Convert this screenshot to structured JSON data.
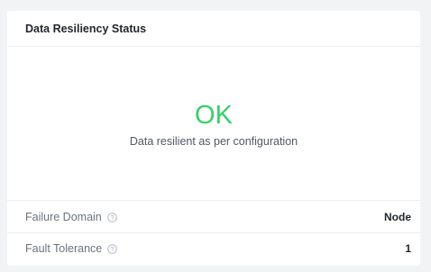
{
  "widget": {
    "title": "Data Resiliency Status",
    "status": {
      "value": "OK",
      "description": "Data resilient as per configuration",
      "color": "#36d068"
    },
    "rows": [
      {
        "label": "Failure Domain",
        "value": "Node",
        "icon": "help-icon"
      },
      {
        "label": "Fault Tolerance",
        "value": "1",
        "icon": "help-icon"
      }
    ]
  }
}
